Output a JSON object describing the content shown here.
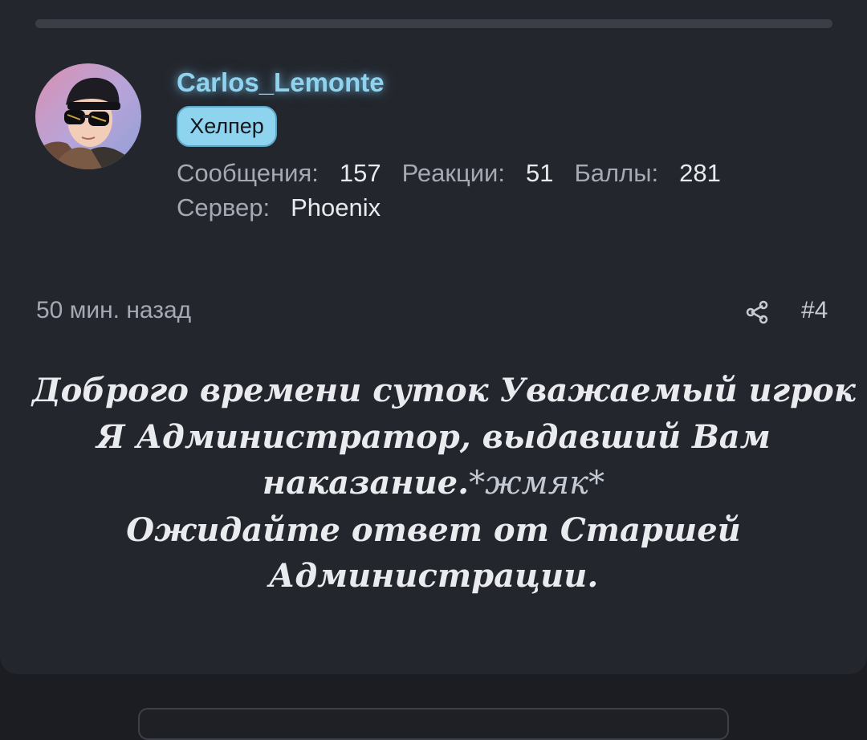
{
  "post": {
    "author": {
      "username": "Carlos_Lemonte",
      "role": "Хелпер",
      "colors": {
        "username": "#8fd3ee",
        "badge": "#8ed4ee"
      }
    },
    "stats": {
      "messages_label": "Сообщения:",
      "messages_value": "157",
      "reactions_label": "Реакции:",
      "reactions_value": "51",
      "points_label": "Баллы:",
      "points_value": "281",
      "server_label": "Сервер:",
      "server_value": "Phoenix"
    },
    "meta": {
      "time": "50 мин. назад",
      "share_icon": "share-icon",
      "post_number": "#4"
    },
    "message": {
      "line1": "Доброго времени суток Уважаемый игрок",
      "line2": "Я Администратор, выдавший Вам",
      "line3": "наказание.",
      "line3_emote": "*жмяк*",
      "line4": "Ожидайте ответ от Старшей",
      "line5": "Администрации."
    }
  }
}
